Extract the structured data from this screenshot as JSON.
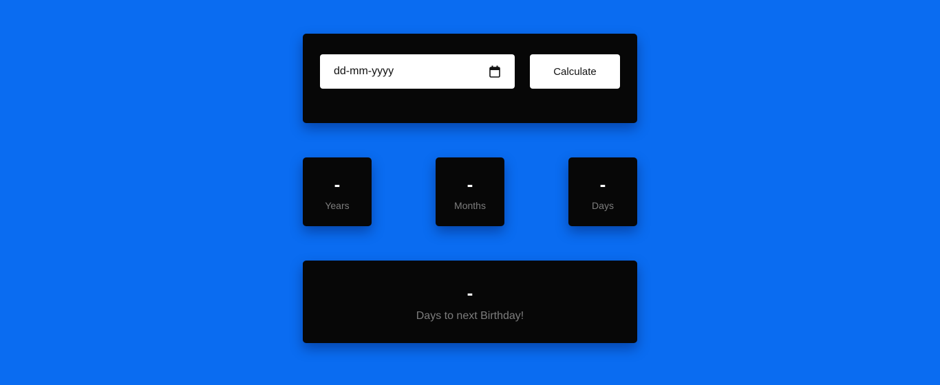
{
  "input_card": {
    "date_placeholder": "dd-mm-yyyy",
    "calendar_icon": "calendar-icon",
    "calculate_label": "Calculate"
  },
  "stats": {
    "years": {
      "value": "-",
      "label": "Years"
    },
    "months": {
      "value": "-",
      "label": "Months"
    },
    "days": {
      "value": "-",
      "label": "Days"
    }
  },
  "birthday": {
    "value": "-",
    "label": "Days to next Birthday!"
  },
  "colors": {
    "background": "#0a6cf1",
    "card": "#070707",
    "label_text": "#7d7d7d",
    "value_text": "#ffffff",
    "field_background": "#ffffff"
  }
}
